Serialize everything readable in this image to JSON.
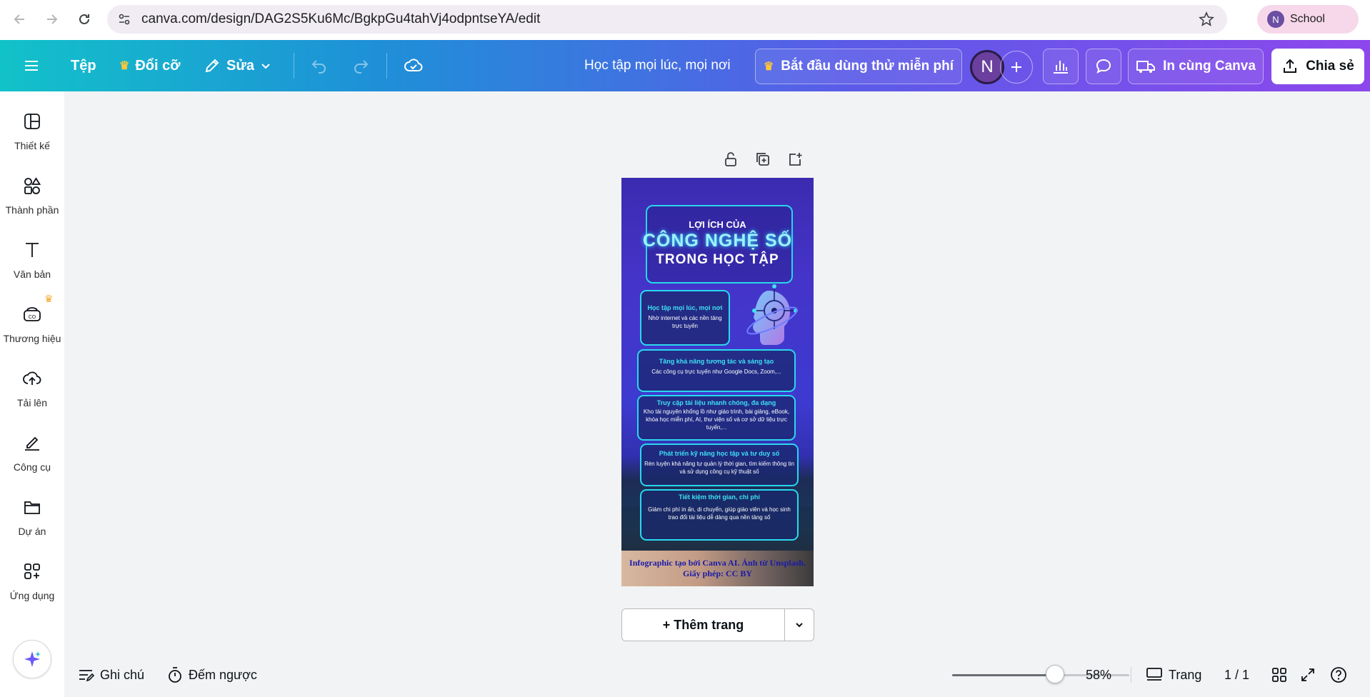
{
  "browser": {
    "url": "canva.com/design/DAG2S5Ku6Mc/BgkpGu4tahVj4odpntseYA/edit",
    "profile_initial": "N",
    "profile_label": "School"
  },
  "toolbar": {
    "file_label": "Tệp",
    "resize_label": "Đổi cỡ",
    "edit_label": "Sửa",
    "doc_title": "Học tập mọi lúc, mọi nơi",
    "trial_label": "Bắt đầu dùng thử miễn phí",
    "avatar_initial": "N",
    "print_label": "In cùng Canva",
    "share_label": "Chia sẻ"
  },
  "sidebar": {
    "items": [
      {
        "label": "Thiết kế",
        "icon": "design-icon"
      },
      {
        "label": "Thành phần",
        "icon": "elements-icon"
      },
      {
        "label": "Văn bản",
        "icon": "text-icon"
      },
      {
        "label": "Thương hiệu",
        "icon": "brand-icon"
      },
      {
        "label": "Tải lên",
        "icon": "upload-icon"
      },
      {
        "label": "Công cụ",
        "icon": "tools-icon"
      },
      {
        "label": "Dự án",
        "icon": "projects-icon"
      },
      {
        "label": "Ứng dụng",
        "icon": "apps-icon"
      }
    ]
  },
  "design": {
    "title_line1": "LỢI ÍCH CỦA",
    "title_line2": "CÔNG NGHỆ SỐ",
    "title_line3": "TRONG HỌC TẬP",
    "cards": [
      {
        "title": "Học tập mọi lúc, mọi nơi",
        "body": "Nhờ internet và các nền tảng trực tuyến"
      },
      {
        "title": "Tăng khả năng tương tác và sáng tạo",
        "body": "Các công cụ trực tuyến như Google Docs, Zoom,..."
      },
      {
        "title": "Truy cập tài liệu nhanh chóng, đa dạng",
        "body": "Kho tài nguyên khổng lồ như giáo trình, bài giảng, eBook, khóa học miễn phí, AI, thư viện số và cơ sở dữ liệu trực tuyến,..."
      },
      {
        "title": "Phát triển kỹ năng học tập và tư duy số",
        "body": "Rèn luyện khả năng tự quản lý thời gian, tìm kiếm thông tin và sử dụng công cụ kỹ thuật số"
      },
      {
        "title": "Tiết kiệm thời gian, chi phí",
        "body": "Giảm chi phí in ấn, di chuyển, giúp giáo viên và học sinh trao đổi tài liệu dễ dàng qua nền tảng số"
      }
    ],
    "caption": "Infographic tạo bởi Canva AI. Ảnh từ Unsplash. Giấy phép: CC BY"
  },
  "canvas": {
    "add_page_label": "+ Thêm trang"
  },
  "bottom": {
    "notes_label": "Ghi chú",
    "timer_label": "Đếm ngược",
    "zoom": "58%",
    "zoom_fraction": 0.58,
    "pages_label": "Trang",
    "page_count": "1 / 1"
  },
  "colors": {
    "accent_cyan": "#2ad8ee",
    "toolbar_start": "#12c2c9",
    "toolbar_end": "#8d47ec"
  }
}
